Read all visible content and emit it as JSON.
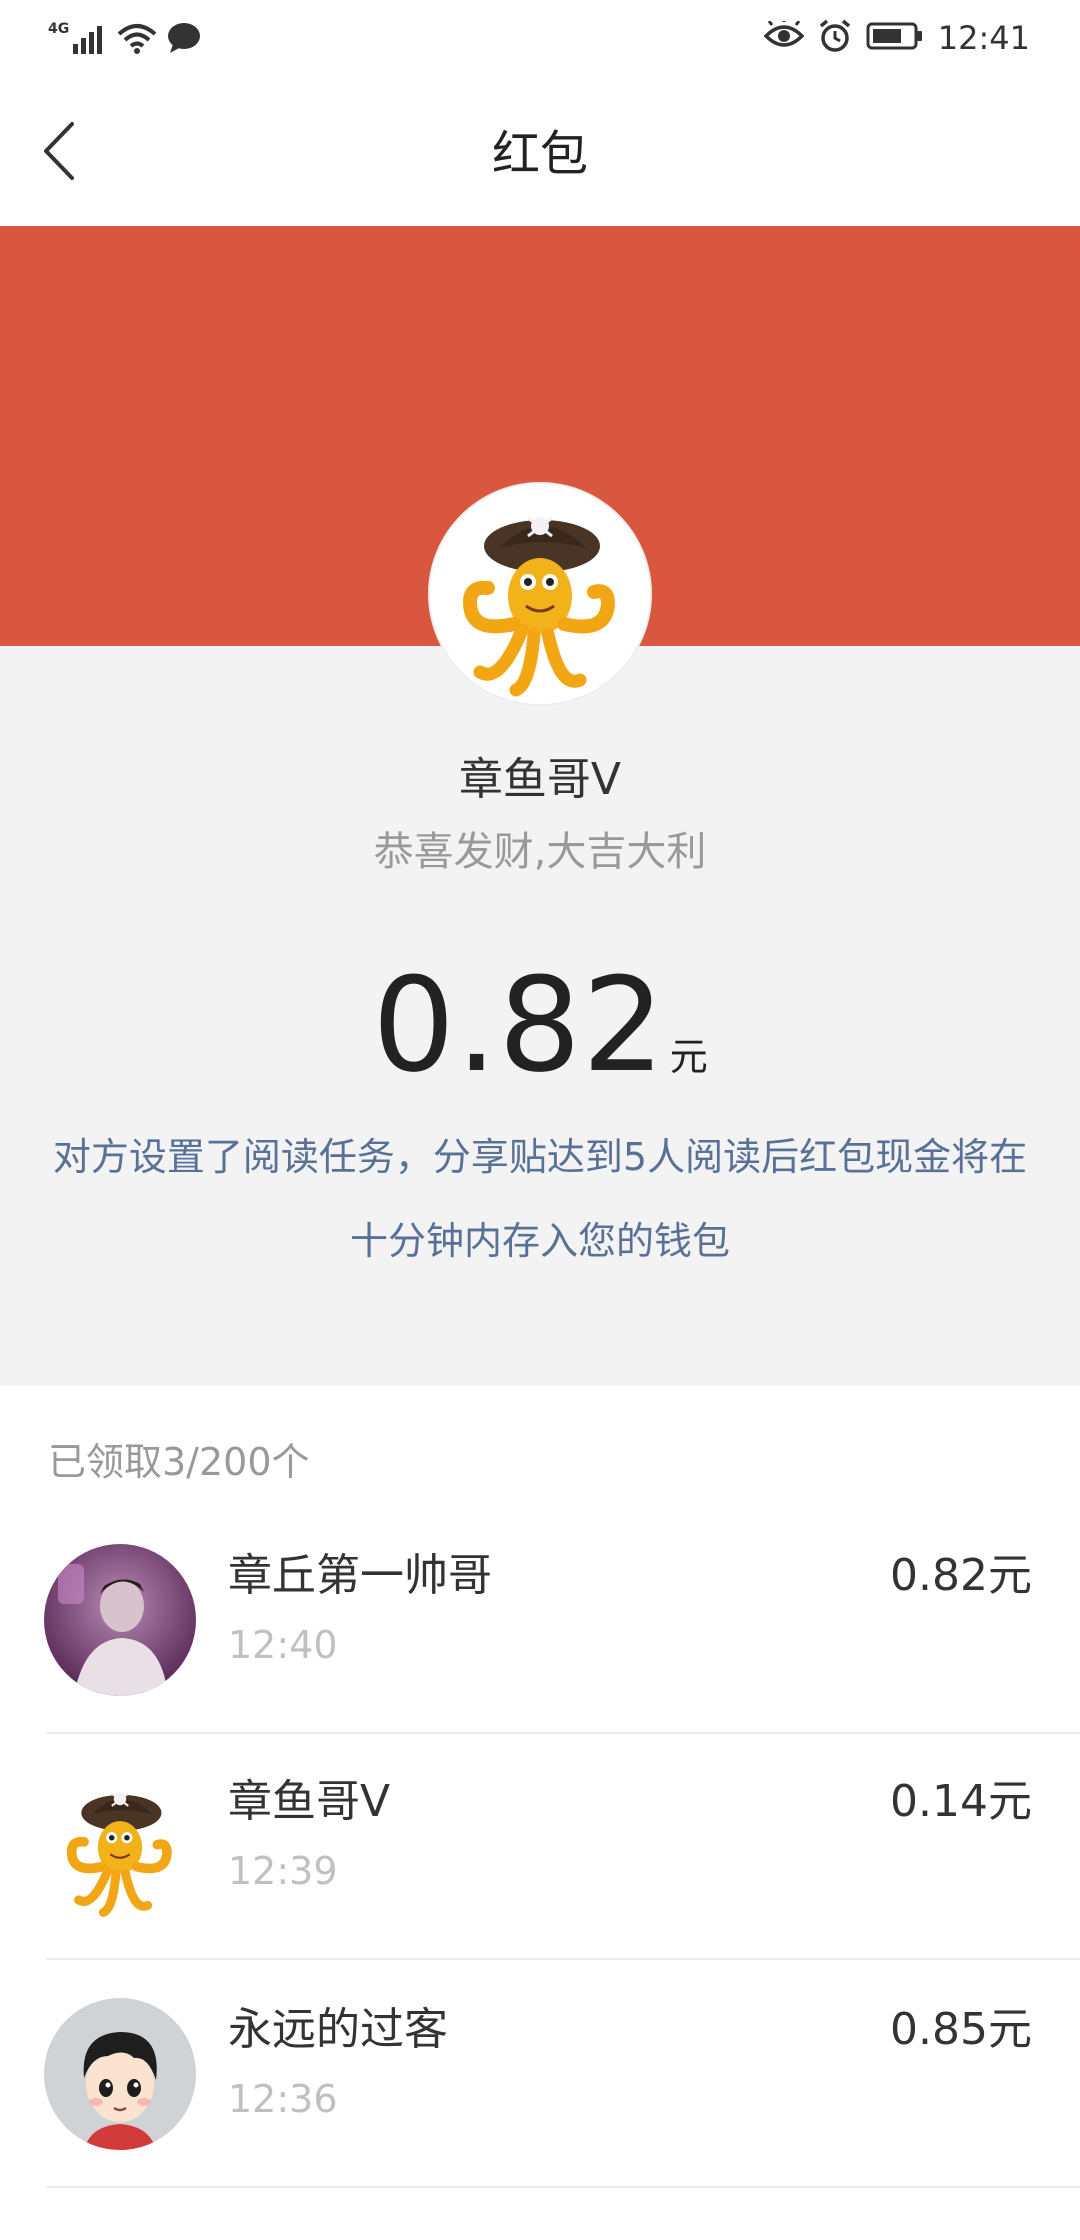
{
  "status_bar": {
    "network": "4G",
    "time": "12:41",
    "icons": [
      "signal-icon",
      "wifi-icon",
      "message-icon",
      "eye-icon",
      "alarm-icon",
      "battery-icon"
    ]
  },
  "header": {
    "title": "红包",
    "back_icon": "chevron-left-icon"
  },
  "colors": {
    "accent_red": "#d9573f",
    "page_bg": "#f3f3f3",
    "task_text": "#5a7197"
  },
  "sender": {
    "name": "章鱼哥V",
    "blessing": "恭喜发财,大吉大利",
    "avatar": "octopus-pirate-avatar"
  },
  "amount": {
    "value": "0.82",
    "unit": "元"
  },
  "task_message": {
    "line1": "对方设置了阅读任务，分享贴达到5人阅读后红包现金将在",
    "line2": "十分钟内存入您的钱包"
  },
  "claims": {
    "summary": "已领取3/200个",
    "items": [
      {
        "name": "章丘第一帅哥",
        "time": "12:40",
        "amount": "0.82元",
        "avatar": "photo-avatar"
      },
      {
        "name": "章鱼哥V",
        "time": "12:39",
        "amount": "0.14元",
        "avatar": "octopus-pirate-avatar"
      },
      {
        "name": "永远的过客",
        "time": "12:36",
        "amount": "0.85元",
        "avatar": "cartoon-boy-avatar"
      }
    ]
  }
}
